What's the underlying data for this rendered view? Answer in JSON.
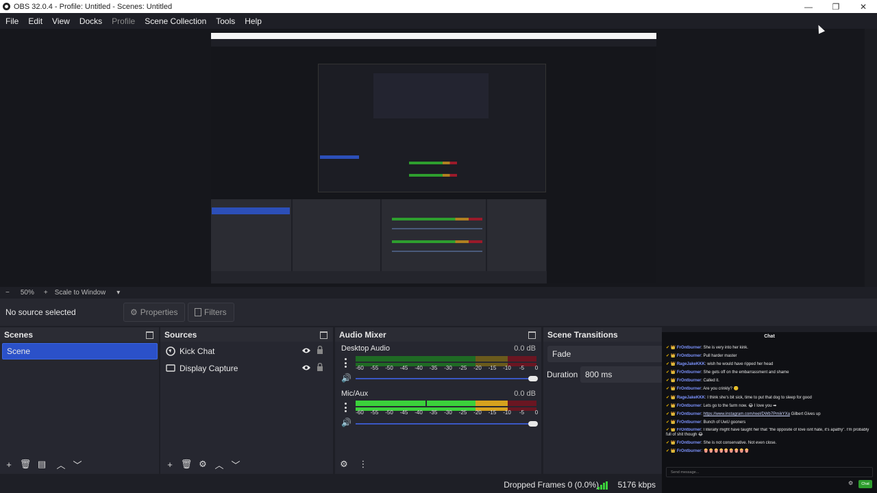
{
  "window": {
    "title": "OBS 32.0.4 - Profile: Untitled - Scenes: Untitled",
    "minimize": "—",
    "restore": "❐",
    "close": "✕"
  },
  "menu": [
    "File",
    "Edit",
    "View",
    "Docks",
    "Profile",
    "Scene Collection",
    "Tools",
    "Help"
  ],
  "zoom": {
    "minus": "−",
    "level": "50%",
    "plus": "+",
    "mode": "Scale to Window",
    "caret": "▾"
  },
  "context": {
    "status": "No source selected",
    "properties": "Properties",
    "filters": "Filters"
  },
  "scenes": {
    "title": "Scenes",
    "items": [
      "Scene"
    ]
  },
  "sources": {
    "title": "Sources",
    "items": [
      "Kick Chat",
      "Display Capture"
    ]
  },
  "audio": {
    "title": "Audio Mixer",
    "scale": [
      "-60",
      "-55",
      "-50",
      "-45",
      "-40",
      "-35",
      "-30",
      "-25",
      "-20",
      "-15",
      "-10",
      "-5",
      "0"
    ],
    "channels": [
      {
        "name": "Desktop Audio",
        "db": "0.0 dB",
        "level": 0.0
      },
      {
        "name": "Mic/Aux",
        "db": "0.0 dB",
        "level": 0.85
      }
    ]
  },
  "transitions": {
    "title": "Scene Transitions",
    "selected": "Fade",
    "duration_label": "Duration",
    "duration": "800 ms"
  },
  "chat": {
    "title": "Chat",
    "messages": [
      {
        "user": "FrOntburner",
        "text": "She is very into her kink."
      },
      {
        "user": "FrOntburner",
        "text": "Pull harder master"
      },
      {
        "user": "RageJakeKKK",
        "text": "wish he would have ripped her head"
      },
      {
        "user": "FrOntburner",
        "text": "She gets off on the embarrassment and shame"
      },
      {
        "user": "FrOntburner",
        "text": "Called it."
      },
      {
        "user": "FrOntburner",
        "text": "Are you crinkly? 🙂"
      },
      {
        "user": "RageJakeKKK",
        "text": "I think she's bit sick, time to put that dog to sleep for good"
      },
      {
        "user": "FrOntburner",
        "text": "Lets go to the farm now. 😂 I love you ➡"
      },
      {
        "user": "FrOntburner",
        "link": "https://www.instagram.com/reel/DWb7PmikYXa",
        "text": " Gilbert Gives up"
      },
      {
        "user": "FrOntburner",
        "text": "Bunch of UwU gooners"
      },
      {
        "user": "FrOntburner",
        "text": "I literally might have taught her that \"the opposite of love isnt hate, it's apathy\". I'm probably full of shit though 😂",
        "wrap": true
      },
      {
        "user": "FrOntburner",
        "text": "She is not conservative. Not even close."
      },
      {
        "user": "FrOntburner",
        "text": "🍿🍿🍿🍿🍿🍿🍿🍿🍿"
      }
    ],
    "placeholder": "Send message...",
    "send": "Chat"
  },
  "status": {
    "dropped": "Dropped Frames 0 (0.0%)",
    "bitrate": "5176 kbps"
  },
  "colors": {
    "accent": "#2b51c9",
    "meter_green": "#3bd13b",
    "meter_yellow": "#d6a21e",
    "meter_red": "#b0182c"
  }
}
